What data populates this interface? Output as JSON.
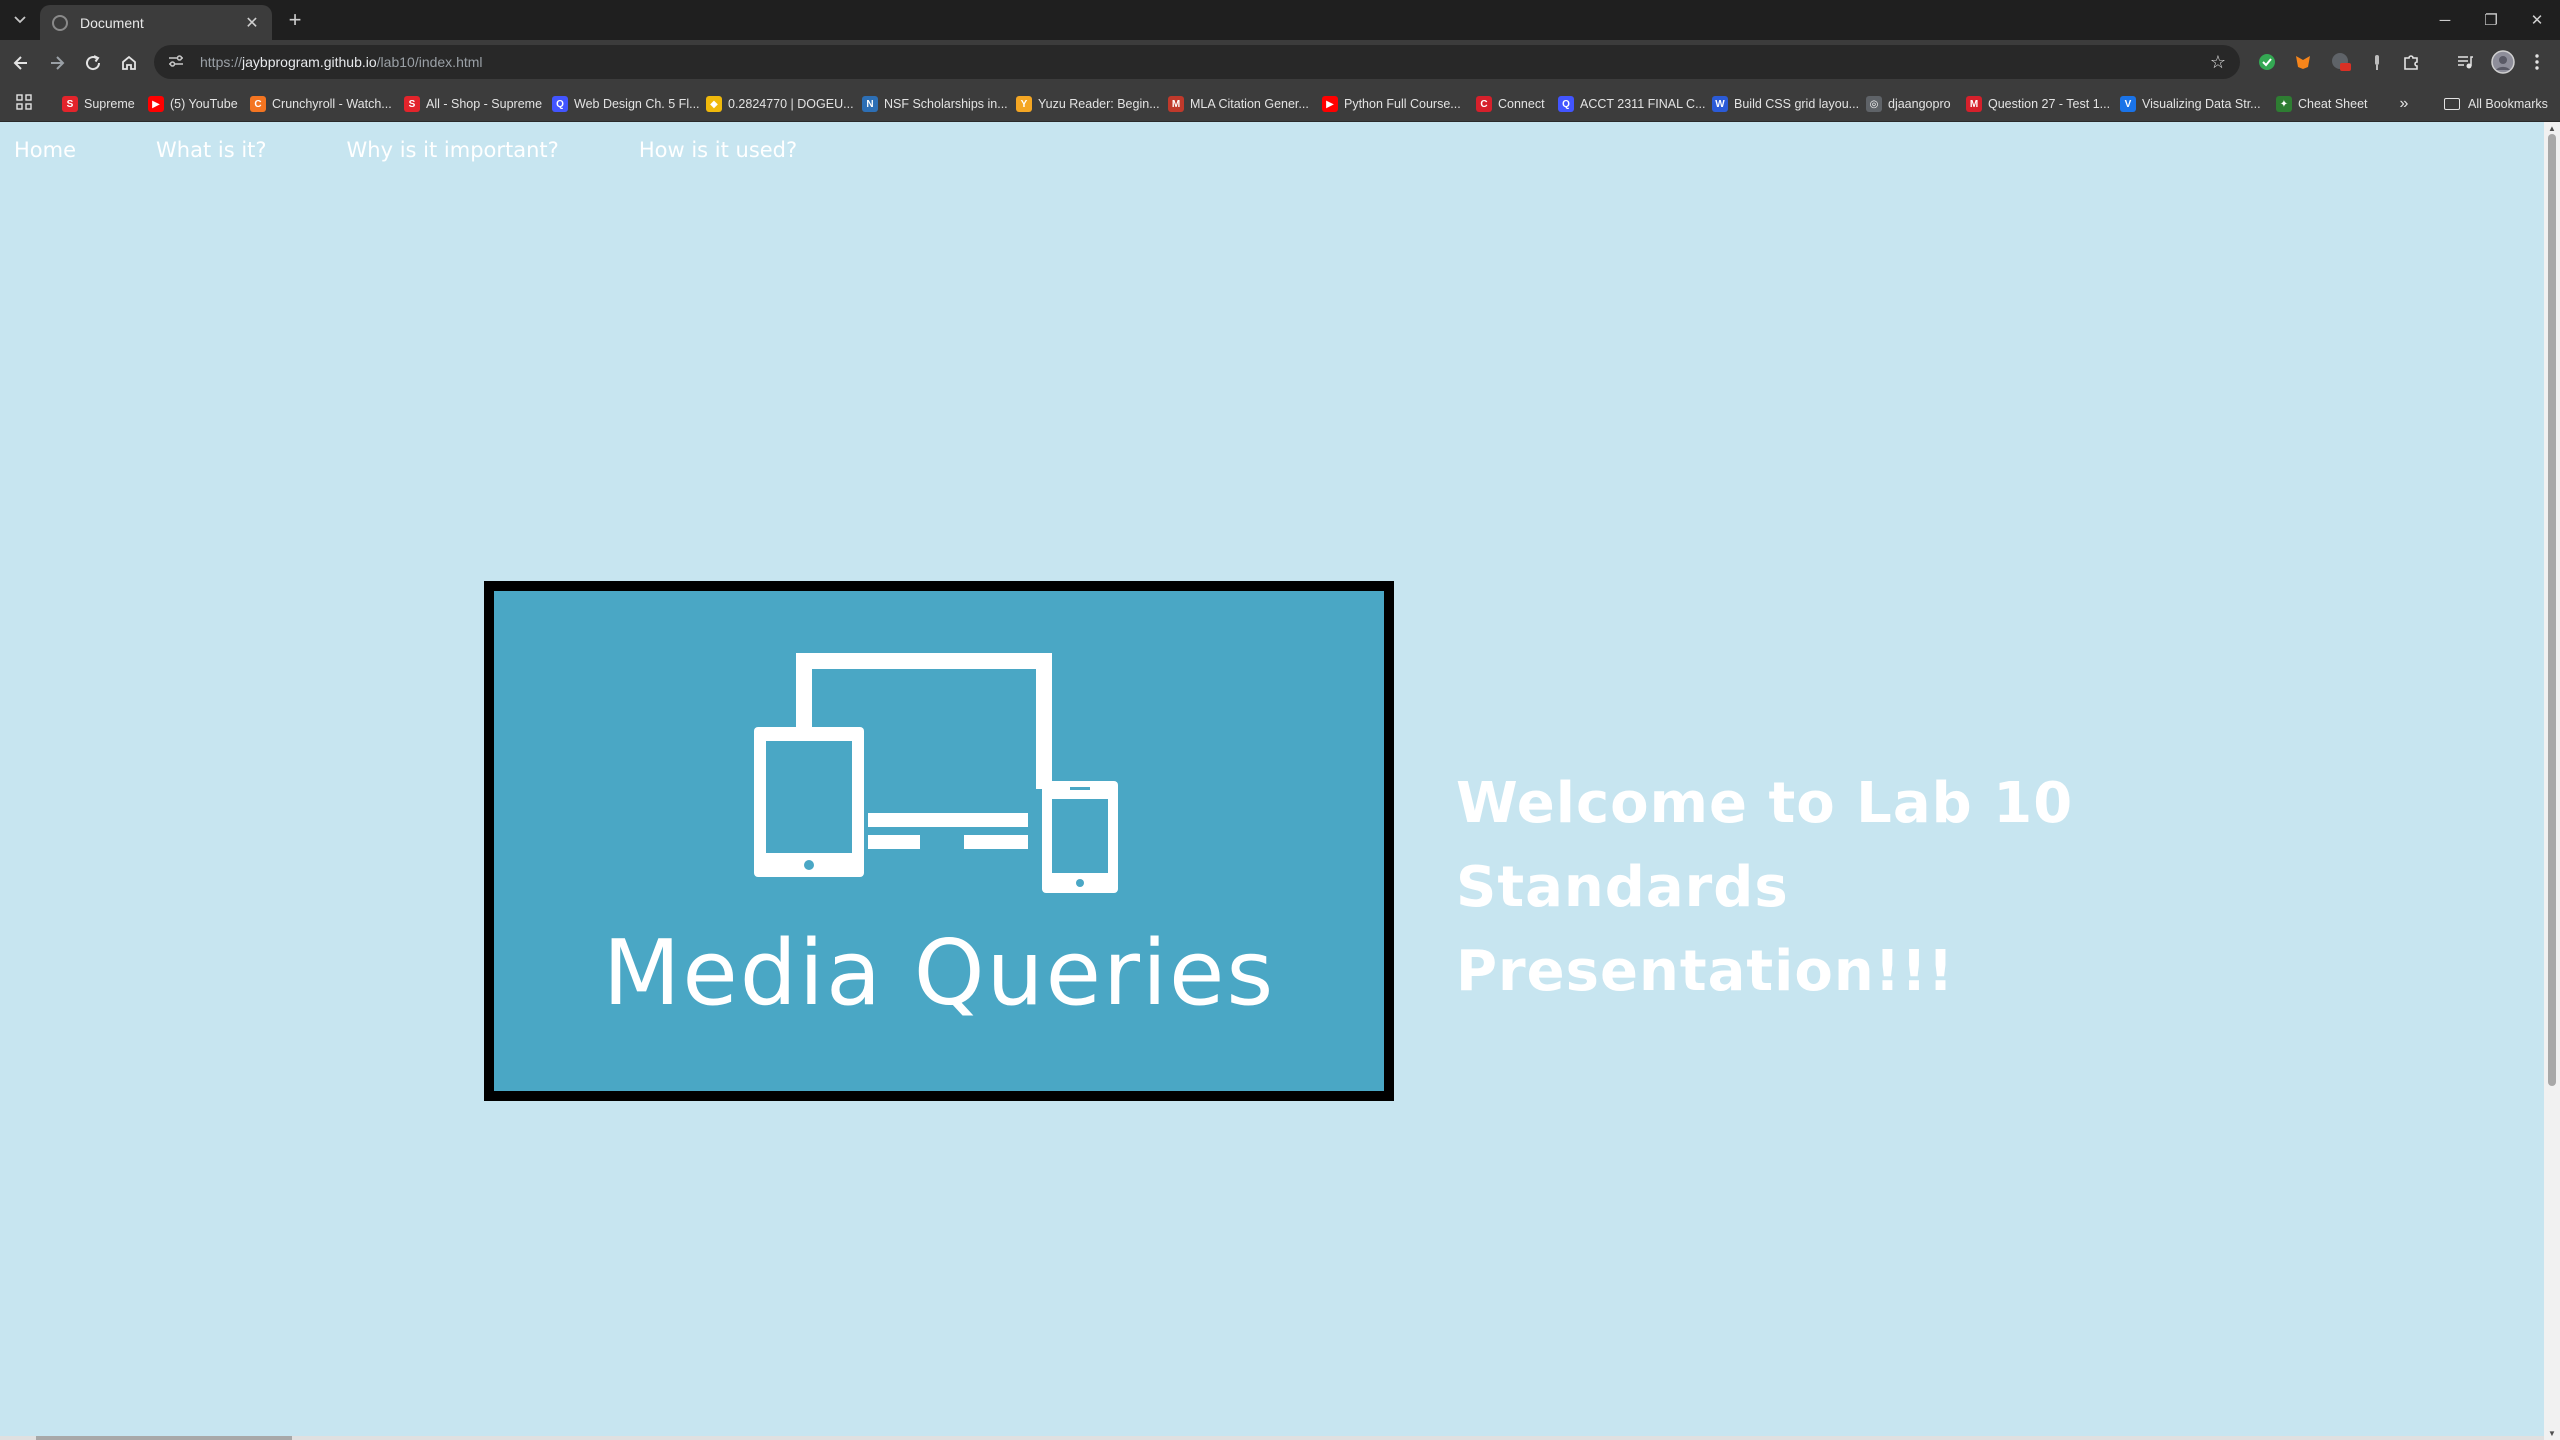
{
  "browser": {
    "tab": {
      "title": "Document",
      "close_glyph": "✕"
    },
    "new_tab_glyph": "+",
    "url": {
      "scheme": "https://",
      "host": "jaybprogram.github.io",
      "path": "/lab10/index.html"
    },
    "window_controls": {
      "minimize": "─",
      "restore": "❐",
      "close": "✕"
    }
  },
  "bookmarks": [
    {
      "label": "Supreme",
      "icon": "supreme-icon",
      "color": "#e3242b",
      "glyph": "S"
    },
    {
      "label": "(5) YouTube",
      "icon": "youtube-icon",
      "color": "#ff0000",
      "glyph": "▶"
    },
    {
      "label": "Crunchyroll - Watch...",
      "icon": "crunchyroll-icon",
      "color": "#f47521",
      "glyph": "C"
    },
    {
      "label": "All - Shop - Supreme",
      "icon": "supreme-icon",
      "color": "#e3242b",
      "glyph": "S"
    },
    {
      "label": "Web Design Ch. 5 Fl...",
      "icon": "quizlet-icon",
      "color": "#4255ff",
      "glyph": "Q"
    },
    {
      "label": "0.2824770 | DOGEU...",
      "icon": "binance-icon",
      "color": "#f0b90b",
      "glyph": "◆"
    },
    {
      "label": "NSF Scholarships in...",
      "icon": "nsf-icon",
      "color": "#2d6fb5",
      "glyph": "N"
    },
    {
      "label": "Yuzu Reader: Begin...",
      "icon": "yuzu-icon",
      "color": "#f4a623",
      "glyph": "Y"
    },
    {
      "label": "MLA Citation Gener...",
      "icon": "mla-icon",
      "color": "#c0392b",
      "glyph": "M"
    },
    {
      "label": "Python Full Course...",
      "icon": "youtube-icon",
      "color": "#ff0000",
      "glyph": "▶"
    },
    {
      "label": "Connect",
      "icon": "connect-icon",
      "color": "#d6202b",
      "glyph": "C"
    },
    {
      "label": "ACCT 2311 FINAL C...",
      "icon": "quizlet-icon",
      "color": "#4255ff",
      "glyph": "Q"
    },
    {
      "label": "Build CSS grid layou...",
      "icon": "w3-icon",
      "color": "#2b5bd7",
      "glyph": "W"
    },
    {
      "label": "djaangopro",
      "icon": "globe-icon",
      "color": "#5f6368",
      "glyph": "◎"
    },
    {
      "label": "Question 27 - Test 1...",
      "icon": "mcgraw-icon",
      "color": "#d6202b",
      "glyph": "M"
    },
    {
      "label": "Visualizing Data Str...",
      "icon": "visualgo-icon",
      "color": "#1a73e8",
      "glyph": "V"
    },
    {
      "label": "Cheat Sheet",
      "icon": "cheatsheet-icon",
      "color": "#2e7d32",
      "glyph": "✦"
    }
  ],
  "bookmarks_more": "»",
  "all_bookmarks": "All Bookmarks",
  "site": {
    "nav": [
      "Home",
      "What is it?",
      "Why is it important?",
      "How is it used?"
    ],
    "hero_text": "Media Queries",
    "welcome_line1": "Welcome to Lab 10",
    "welcome_line2": "Standards Presentation!!!"
  },
  "colors": {
    "page_bg": "#c7e5f0",
    "hero_bg": "#4aa7c5",
    "hero_border": "#000000",
    "text": "#ffffff"
  }
}
